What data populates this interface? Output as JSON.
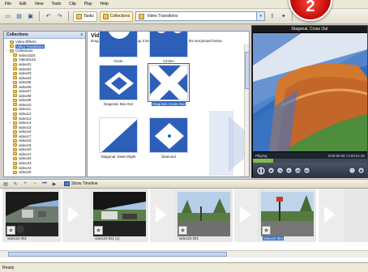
{
  "menu": [
    "File",
    "Edit",
    "View",
    "Tools",
    "Clip",
    "Play",
    "Help"
  ],
  "toolbar": {
    "tasks_label": "Tasks",
    "collections_label": "Collections",
    "dropdown_value": "Video Transitions"
  },
  "badge": "2",
  "collections_pane": {
    "title": "Collections",
    "close": "x",
    "items": [
      {
        "label": "Video Effects",
        "selected": false
      },
      {
        "label": "Video Transitions",
        "selected": true
      },
      {
        "label": "Collections",
        "selected": false
      },
      {
        "label": "video2323",
        "selected": false
      },
      {
        "label": "Video0142",
        "selected": false
      },
      {
        "label": "video01",
        "selected": false
      },
      {
        "label": "video02",
        "selected": false
      },
      {
        "label": "video03",
        "selected": false
      },
      {
        "label": "video04",
        "selected": false
      },
      {
        "label": "video05",
        "selected": false
      },
      {
        "label": "video06",
        "selected": false
      },
      {
        "label": "video07",
        "selected": false
      },
      {
        "label": "video08",
        "selected": false
      },
      {
        "label": "video09",
        "selected": false
      },
      {
        "label": "video10",
        "selected": false
      },
      {
        "label": "video11",
        "selected": false
      },
      {
        "label": "video12",
        "selected": false
      },
      {
        "label": "video13",
        "selected": false
      },
      {
        "label": "video14",
        "selected": false
      },
      {
        "label": "video15",
        "selected": false
      },
      {
        "label": "video16",
        "selected": false
      },
      {
        "label": "video17",
        "selected": false
      },
      {
        "label": "video18",
        "selected": false
      },
      {
        "label": "video19",
        "selected": false
      },
      {
        "label": "video20",
        "selected": false
      },
      {
        "label": "video21",
        "selected": false
      },
      {
        "label": "video22",
        "selected": false
      },
      {
        "label": "video23",
        "selected": false
      },
      {
        "label": "video24",
        "selected": false
      },
      {
        "label": "video25",
        "selected": false
      }
    ]
  },
  "transitions_pane": {
    "title": "Video Transitions",
    "description": "Drag a video transition and drop it between two video clips on the storyboard below.",
    "items": [
      {
        "label": "Circle",
        "selected": false
      },
      {
        "label": "Circles",
        "selected": false
      },
      {
        "label": "Diagonal, Box Out",
        "selected": false
      },
      {
        "label": "Diagonal, Cross Out",
        "selected": true
      },
      {
        "label": "Diagonal, Down Right",
        "selected": false
      },
      {
        "label": "Diamond",
        "selected": false
      }
    ]
  },
  "preview": {
    "title": "Diagonal, Cross Out",
    "status": "Playing",
    "time": "0:00:00.06 / 0:00:01.50",
    "progress": 0.18
  },
  "storyboard": {
    "show_timeline_label": "Show Timeline",
    "clips": [
      {
        "name": "video23 001",
        "selected": false
      },
      {
        "name": "video23 001 (1)",
        "selected": false
      },
      {
        "name": "video23 001",
        "selected": false
      },
      {
        "name": "video23 004",
        "selected": true
      }
    ]
  },
  "status_bar": "Ready",
  "colors": {
    "transition_blue": "#2d5fb8",
    "selection": "#316ac5",
    "badge_red": "#c8100c"
  }
}
